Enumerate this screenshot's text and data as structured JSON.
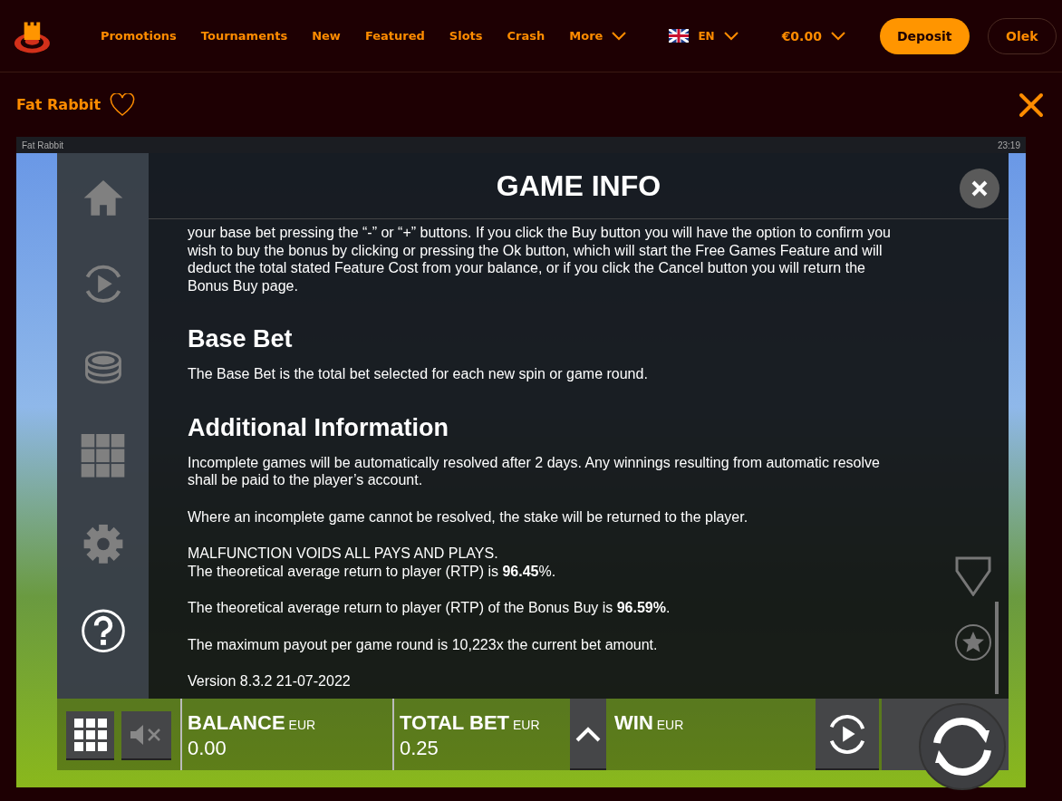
{
  "nav": {
    "items": [
      {
        "label": "Promotions",
        "dropdown": false
      },
      {
        "label": "Tournaments",
        "dropdown": false
      },
      {
        "label": "New",
        "dropdown": false
      },
      {
        "label": "Featured",
        "dropdown": false
      },
      {
        "label": "Slots",
        "dropdown": false
      },
      {
        "label": "Crash",
        "dropdown": false
      },
      {
        "label": "More",
        "dropdown": true
      }
    ],
    "language": "EN",
    "balance": "€0.00",
    "deposit": "Deposit",
    "user": "Olek"
  },
  "game_header": {
    "title": "Fat Rabbit",
    "favorite": false
  },
  "frame": {
    "title": "Fat Rabbit",
    "time": "23:19"
  },
  "info": {
    "title": "GAME INFO",
    "sections": [
      {
        "paragraphs": [
          [
            "your base bet pressing the “-” or “+” buttons. If you click the Buy button you will have the option to confirm you wish to buy the bonus by clicking or pressing the Ok button, which will start the Free Games Feature and will deduct the total stated Feature Cost from your balance, or if you click the Cancel button you will return the Bonus Buy page."
          ]
        ]
      },
      {
        "heading": "Base Bet",
        "paragraphs": [
          [
            "The Base Bet is the total bet selected for each new spin or game round."
          ]
        ]
      },
      {
        "heading": "Additional Information",
        "paragraphs": [
          [
            "Incomplete games will be automatically resolved after 2 days. Any winnings resulting from automatic resolve shall be paid to the player’s account."
          ],
          [
            "Where an incomplete game cannot be resolved, the stake will be returned to the player."
          ],
          [
            "MALFUNCTION VOIDS ALL PAYS AND PLAYS.",
            "The theoretical average return to player (RTP) is **96.45**%."
          ],
          [
            "The theoretical average return to player (RTP) of the Bonus Buy is **96.59%**."
          ],
          [
            "The maximum payout per game round is 10,223x the current bet amount."
          ],
          [
            "Version 8.3.2 21-07-2022"
          ]
        ]
      }
    ]
  },
  "bottom_bar": {
    "fields": [
      {
        "label": "BALANCE",
        "currency": "EUR",
        "value": "0.00"
      },
      {
        "label": "TOTAL BET",
        "currency": "EUR",
        "value": "0.25"
      },
      {
        "label": "WIN",
        "currency": "EUR"
      }
    ],
    "sound_muted": true
  }
}
